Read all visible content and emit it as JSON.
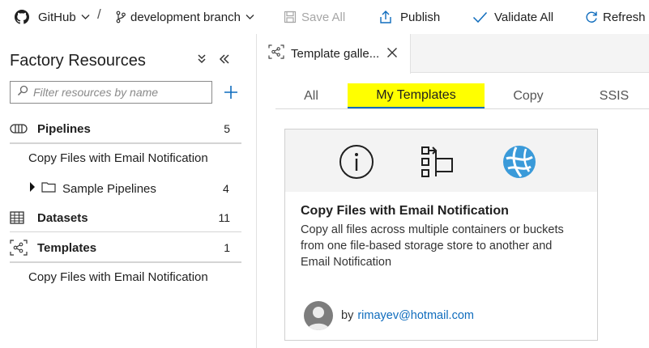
{
  "toolbar": {
    "repo": "GitHub",
    "separator": "/",
    "branch": "development branch",
    "save_all": "Save All",
    "publish": "Publish",
    "validate_all": "Validate All",
    "refresh": "Refresh"
  },
  "sidebar": {
    "title": "Factory Resources",
    "filter_placeholder": "Filter resources by name",
    "groups": [
      {
        "label": "Pipelines",
        "count": "5",
        "items": [
          "Copy Files with Email Notification"
        ],
        "folder": {
          "label": "Sample Pipelines",
          "count": "4"
        }
      },
      {
        "label": "Datasets",
        "count": "11"
      },
      {
        "label": "Templates",
        "count": "1",
        "items": [
          "Copy Files with Email Notification"
        ]
      }
    ]
  },
  "tabs": {
    "doc_tab_label": "Template galle..."
  },
  "pivots": [
    "All",
    "My Templates",
    "Copy",
    "SSIS"
  ],
  "card": {
    "title": "Copy Files with Email Notification",
    "description": "Copy all files across multiple containers or buckets from one file-based storage store to another and Email Notification",
    "by_label": "by",
    "author_email": "rimayev@hotmail.com"
  },
  "colors": {
    "accent": "#0f6cbd",
    "highlight": "#ffff00",
    "azure_globe": "#3a9ad9"
  }
}
